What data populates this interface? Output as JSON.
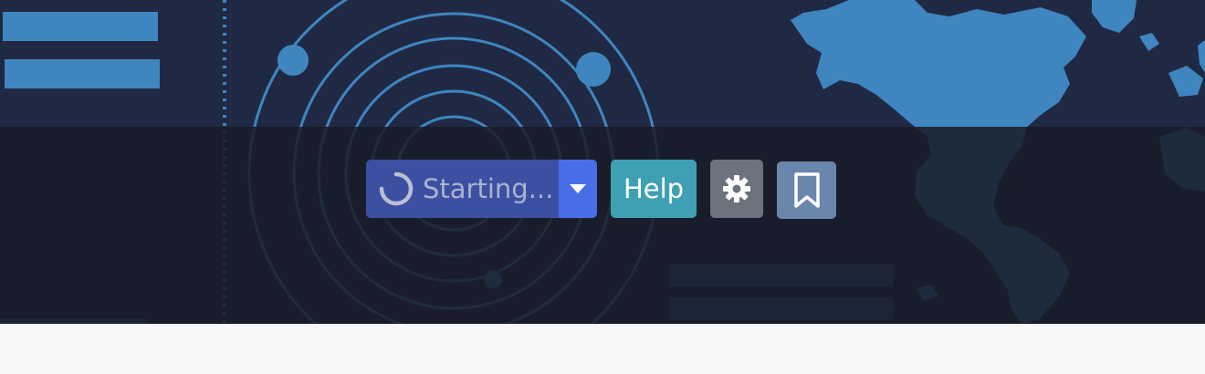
{
  "toolbar": {
    "start_button_label": "Starting...",
    "start_state_icon": "spinner-icon",
    "dropdown_icon": "caret-down-icon",
    "help_label": "Help",
    "settings_icon": "gear-icon",
    "bookmark_icon": "bookmark-icon"
  },
  "colors": {
    "hero_background": "#202944",
    "overlay": "#181c28",
    "start_button": "#3d4fa0",
    "dropdown": "#4a6ee8",
    "help": "#3fa0b3",
    "settings": "#6c737e",
    "bookmark": "#6a86ad",
    "page_background": "#f7f8fa"
  }
}
